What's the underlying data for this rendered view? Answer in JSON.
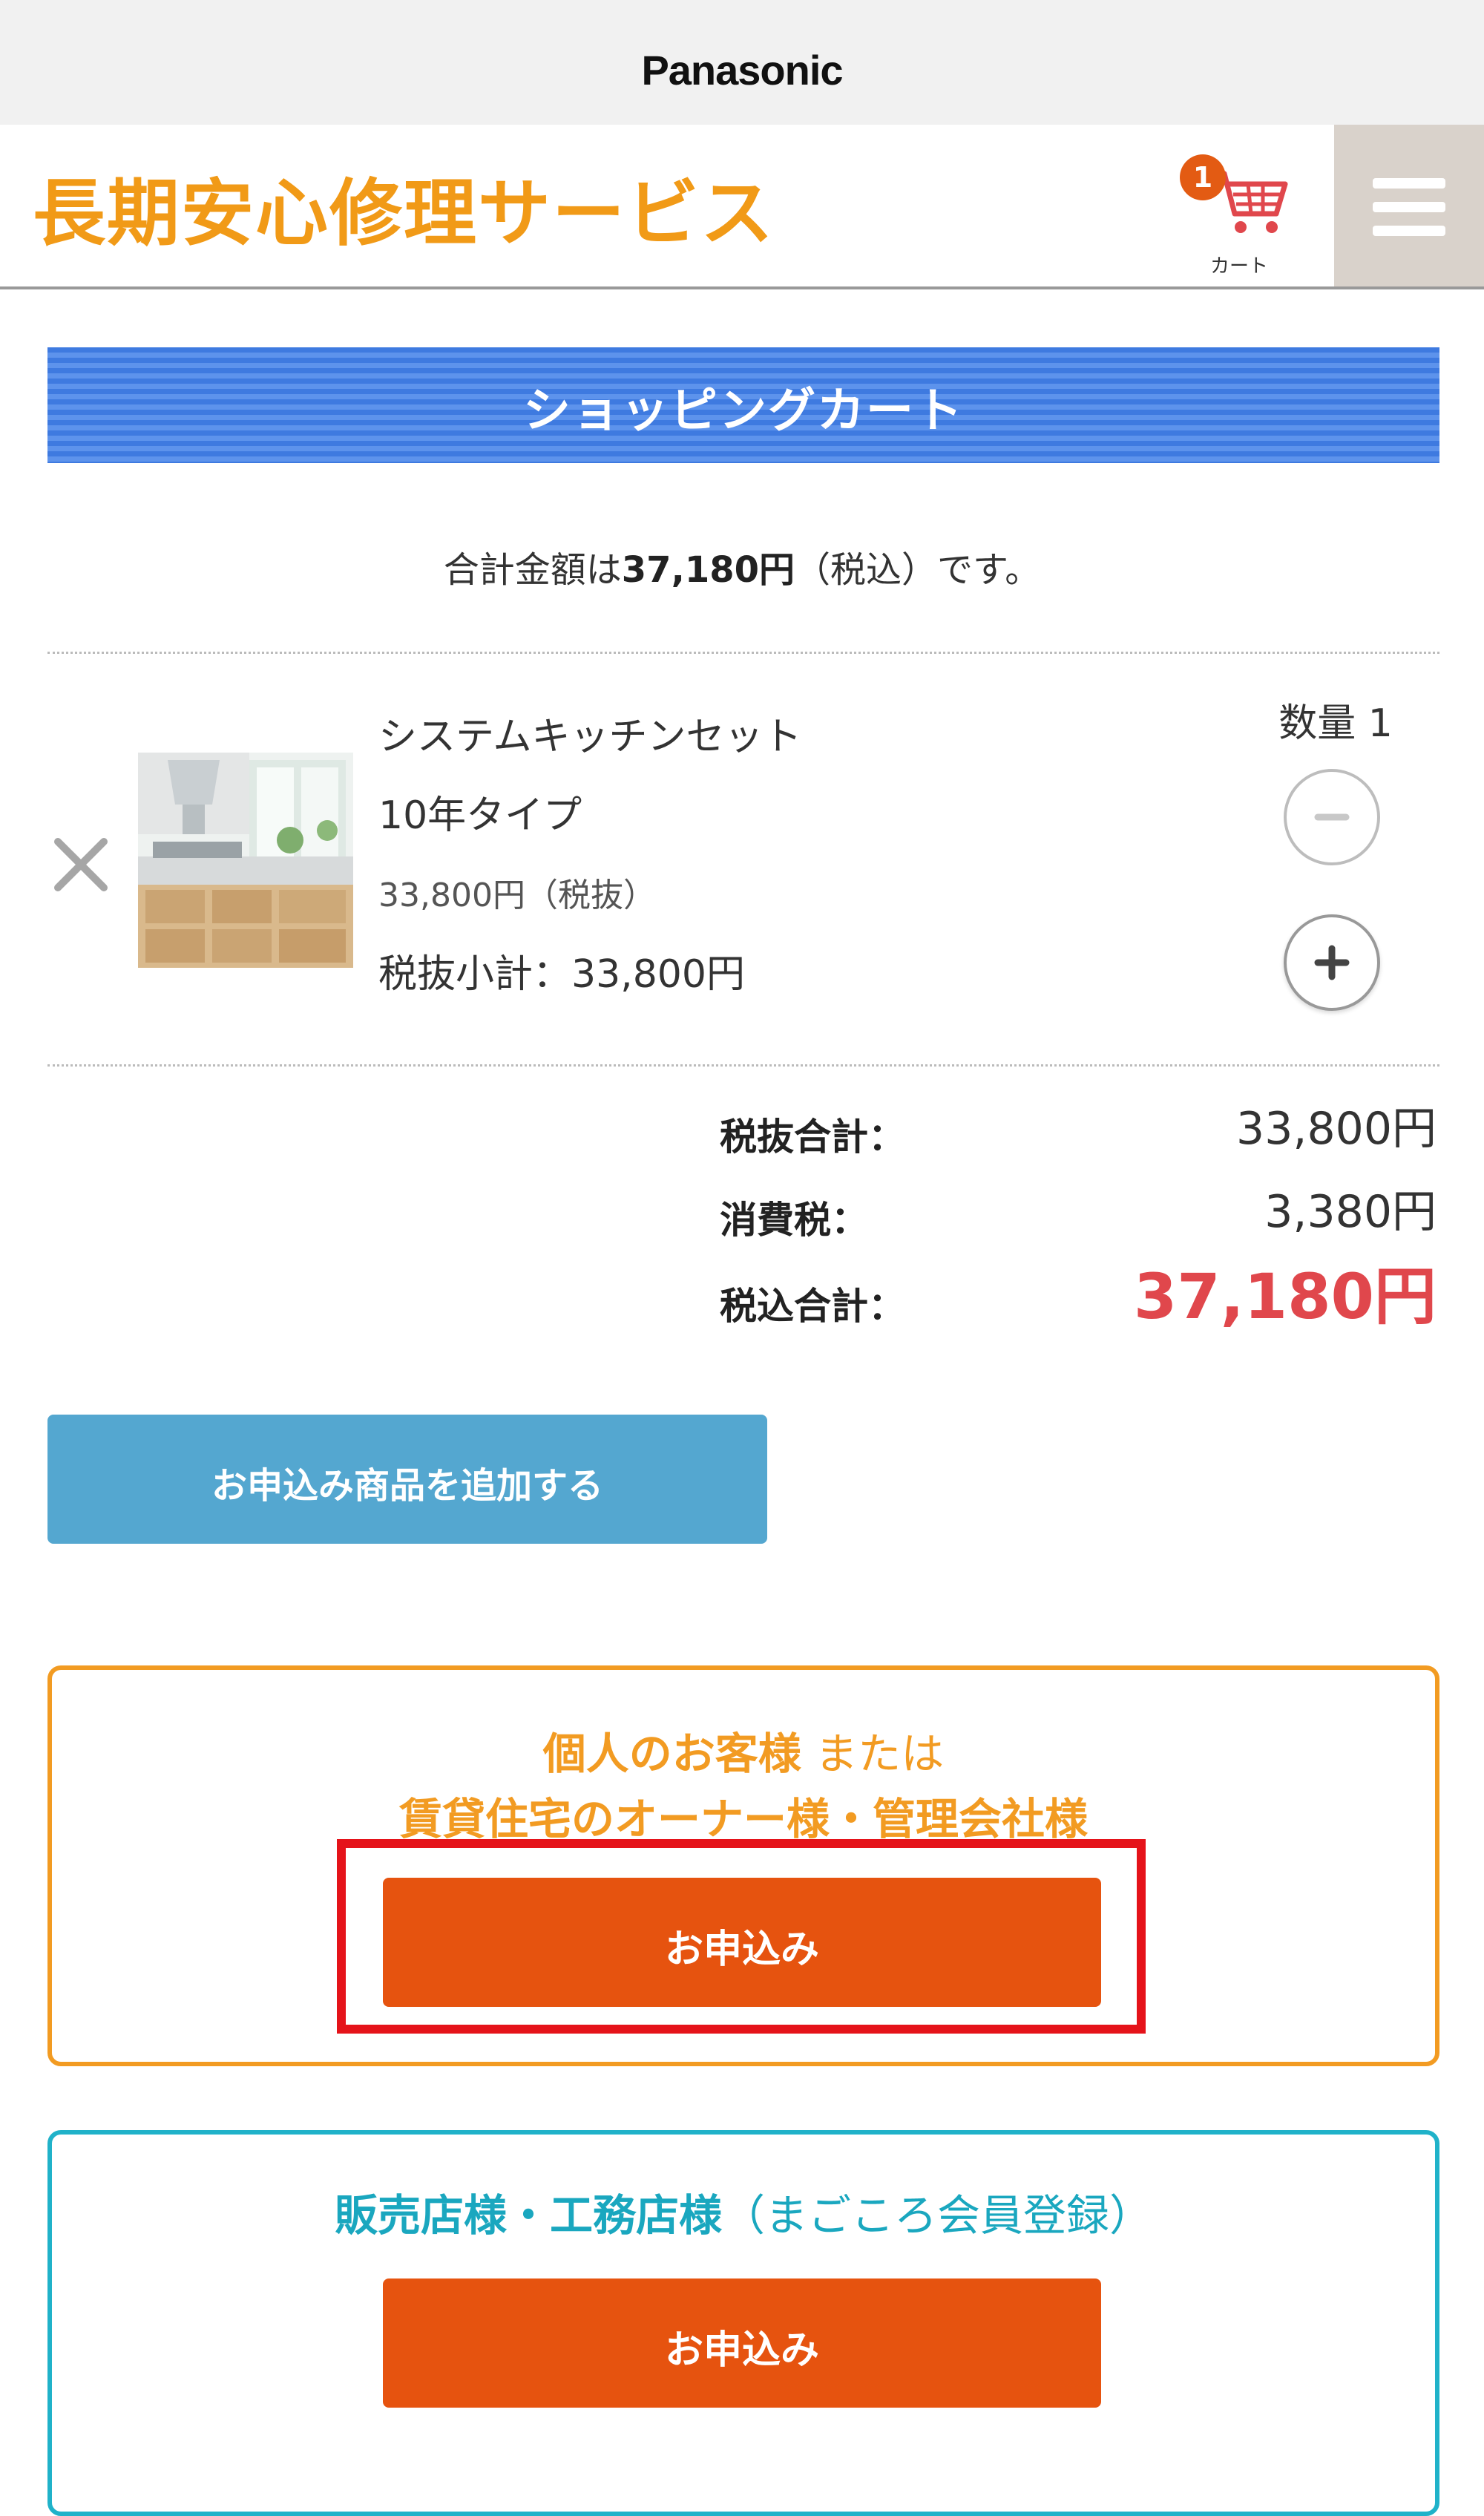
{
  "brand": "Panasonic",
  "header": {
    "logo_text": "長期安心修理サービス",
    "cart_count": "1",
    "cart_label": "カート"
  },
  "section_title": "ショッピングカート",
  "summary": {
    "prefix": "合計金額は",
    "amount": "37,180円",
    "suffix": "（税込）です。"
  },
  "cart_item": {
    "name": "システムキッチンセット",
    "type": "10年タイプ",
    "price": "33,800円（税抜）",
    "subtotal": "税抜小計：33,800円",
    "qty_label": "数量 1"
  },
  "totals": {
    "subtotal_label": "税抜合計：",
    "subtotal_value": "33,800円",
    "tax_label": "消費税：",
    "tax_value": "3,380円",
    "total_label": "税込合計：",
    "total_value": "37,180円"
  },
  "add_button": "お申込み商品を追加する",
  "individual_box": {
    "title_bold": "個人のお客様",
    "title_normal": " または",
    "line2": "賃貸住宅のオーナー様・管理会社様",
    "button": "お申込み"
  },
  "dealer_box": {
    "title_bold": "販売店様・工務店様",
    "title_normal": "（まごころ会員登録）",
    "button": "お申込み"
  },
  "colors": {
    "logo": "#f19a17",
    "section_title": "#3e7ae0",
    "grand_total": "#e0474c",
    "add_button": "#54a7d0",
    "apply_button": "#e6530f",
    "individual_border": "#f29b22",
    "dealer_border": "#20b2c9",
    "highlight": "#e5131a"
  },
  "icons": {
    "cart": "shopping-cart-icon",
    "menu": "hamburger-menu-icon",
    "remove": "close-icon",
    "minus": "minus-icon",
    "plus": "plus-icon"
  }
}
